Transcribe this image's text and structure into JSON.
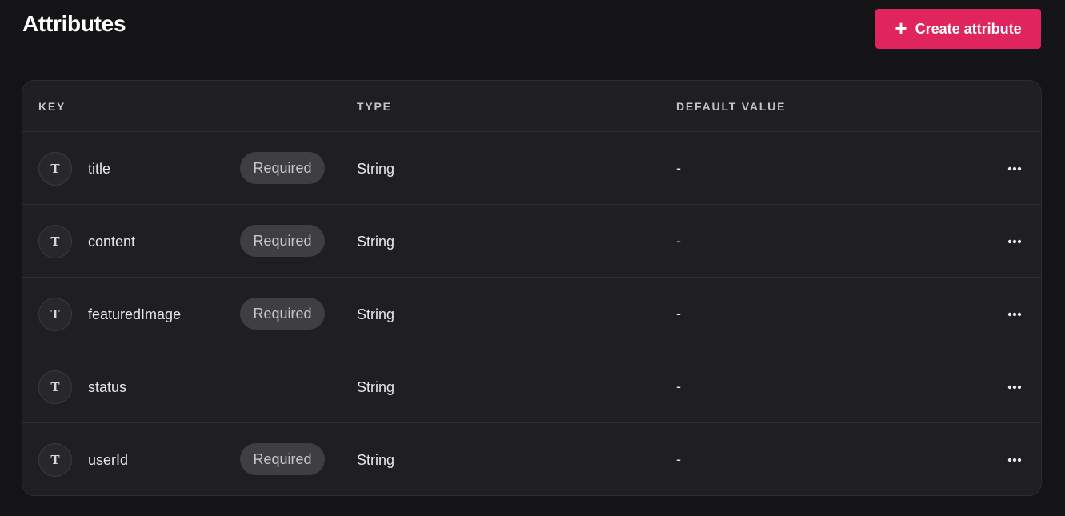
{
  "header": {
    "title": "Attributes",
    "create_button_label": "Create attribute",
    "create_button_icon": "plus-icon",
    "accent_color": "#e0245e"
  },
  "table": {
    "columns": {
      "key": "KEY",
      "type": "TYPE",
      "default_value": "DEFAULT VALUE"
    },
    "rows": [
      {
        "icon": "text-type-icon",
        "icon_glyph": "T",
        "key": "title",
        "required": true,
        "required_label": "Required",
        "type": "String",
        "default": "-"
      },
      {
        "icon": "text-type-icon",
        "icon_glyph": "T",
        "key": "content",
        "required": true,
        "required_label": "Required",
        "type": "String",
        "default": "-"
      },
      {
        "icon": "text-type-icon",
        "icon_glyph": "T",
        "key": "featuredImage",
        "required": true,
        "required_label": "Required",
        "type": "String",
        "default": "-"
      },
      {
        "icon": "text-type-icon",
        "icon_glyph": "T",
        "key": "status",
        "required": false,
        "required_label": "",
        "type": "String",
        "default": "-"
      },
      {
        "icon": "text-type-icon",
        "icon_glyph": "T",
        "key": "userId",
        "required": true,
        "required_label": "Required",
        "type": "String",
        "default": "-"
      }
    ],
    "row_action_icon": "more-horizontal-icon"
  }
}
